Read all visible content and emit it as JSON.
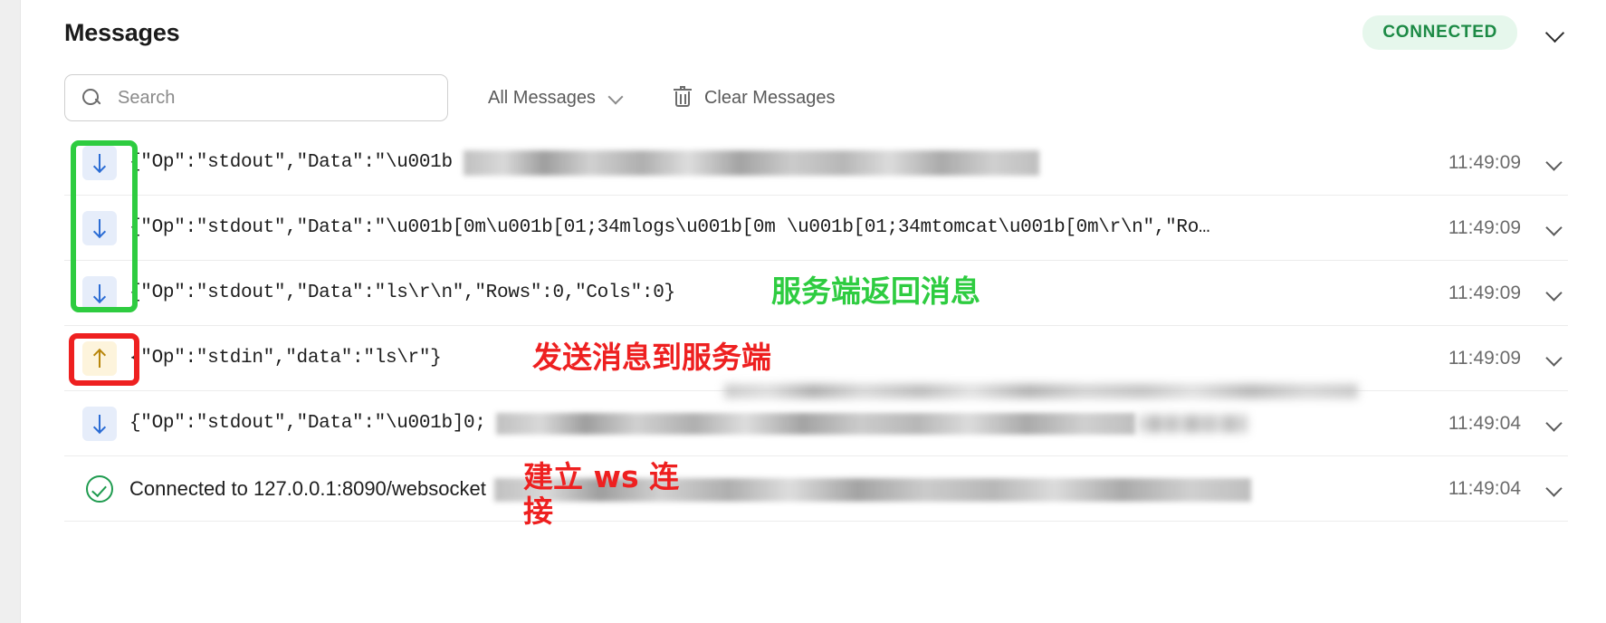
{
  "header": {
    "title": "Messages",
    "status_label": "CONNECTED",
    "status_color": "#1c8a45",
    "status_bg": "#e6f7ec",
    "collapse_icon": "chevron-down-icon"
  },
  "toolbar": {
    "search_placeholder": "Search",
    "search_value": "",
    "search_icon": "search-icon",
    "filter_label": "All Messages",
    "filter_icon": "chevron-down-icon",
    "clear_label": "Clear Messages",
    "clear_icon": "trash-icon"
  },
  "messages": [
    {
      "direction": "in",
      "icon": "arrow-down-icon",
      "text": "{\"Op\":\"stdout\",\"Data\":\"\\u001b",
      "text_tail": "\",\"Rows\":0,\"Cols\"…",
      "time": "11:49:09",
      "expand_icon": "chevron-down-icon"
    },
    {
      "direction": "in",
      "icon": "arrow-down-icon",
      "text": "{\"Op\":\"stdout\",\"Data\":\"\\u001b[0m\\u001b[01;34mlogs\\u001b[0m \\u001b[01;34mtomcat\\u001b[0m\\r\\n\",\"Ro…",
      "text_tail": "",
      "time": "11:49:09",
      "expand_icon": "chevron-down-icon"
    },
    {
      "direction": "in",
      "icon": "arrow-down-icon",
      "text": "{\"Op\":\"stdout\",\"Data\":\"ls\\r\\n\",\"Rows\":0,\"Cols\":0}",
      "text_tail": "",
      "time": "11:49:09",
      "expand_icon": "chevron-down-icon"
    },
    {
      "direction": "out",
      "icon": "arrow-up-icon",
      "text": "{\"Op\":\"stdin\",\"data\":\"ls\\r\"}",
      "text_tail": "",
      "time": "11:49:09",
      "expand_icon": "chevron-down-icon"
    },
    {
      "direction": "in",
      "icon": "arrow-down-icon",
      "text": "{\"Op\":\"stdout\",\"Data\":\"\\u001b]0;",
      "text_tail": "R…",
      "time": "11:49:04",
      "expand_icon": "chevron-down-icon"
    },
    {
      "direction": "system",
      "icon": "check-circle-icon",
      "text": "Connected to 127.0.0.1:8090/websocket",
      "text_tail": "…",
      "time": "11:49:04",
      "expand_icon": "chevron-down-icon"
    }
  ],
  "annotations": [
    {
      "id": "server-messages",
      "text": "服务端返回消息",
      "color": "#2ecc40",
      "kind": "label"
    },
    {
      "id": "send-to-server",
      "text": "发送消息到服务端",
      "color": "#ee2020",
      "kind": "label"
    },
    {
      "id": "establish-ws",
      "text": "建立 ws 连接",
      "color": "#ee2020",
      "kind": "label"
    }
  ]
}
